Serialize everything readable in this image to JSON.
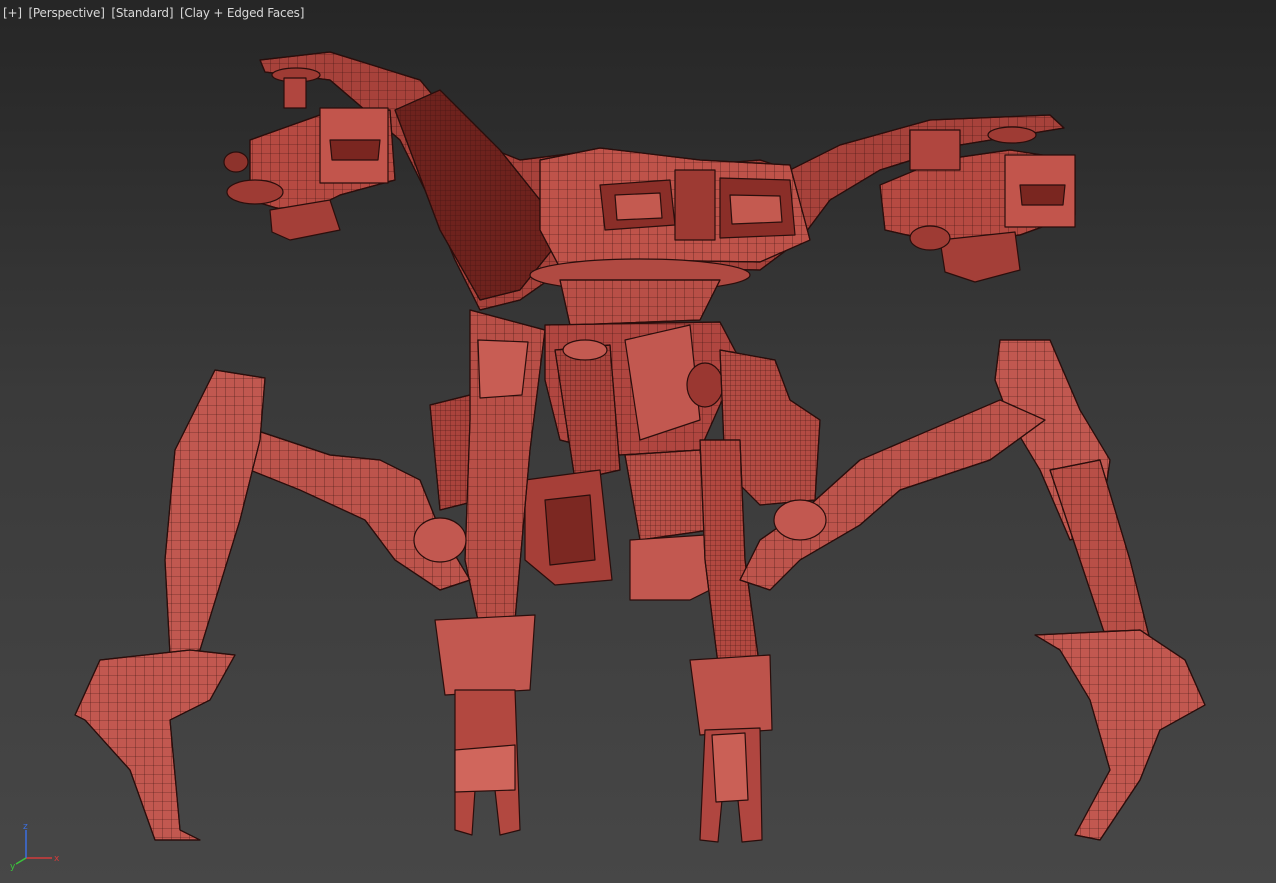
{
  "viewport": {
    "labels": [
      "[+]",
      "[Perspective]",
      "[Standard]",
      "[Clay + Edged Faces]"
    ]
  },
  "axis_gizmo": {
    "x": "x",
    "y": "y",
    "z": "z",
    "colors": {
      "x": "#d23b3b",
      "y": "#3bc43b",
      "z": "#3b6fe0"
    }
  },
  "colors": {
    "clay": "#b64a42",
    "clay_light": "#cf5e55",
    "clay_dark": "#7a2620",
    "edge": "#2a0e0c"
  }
}
